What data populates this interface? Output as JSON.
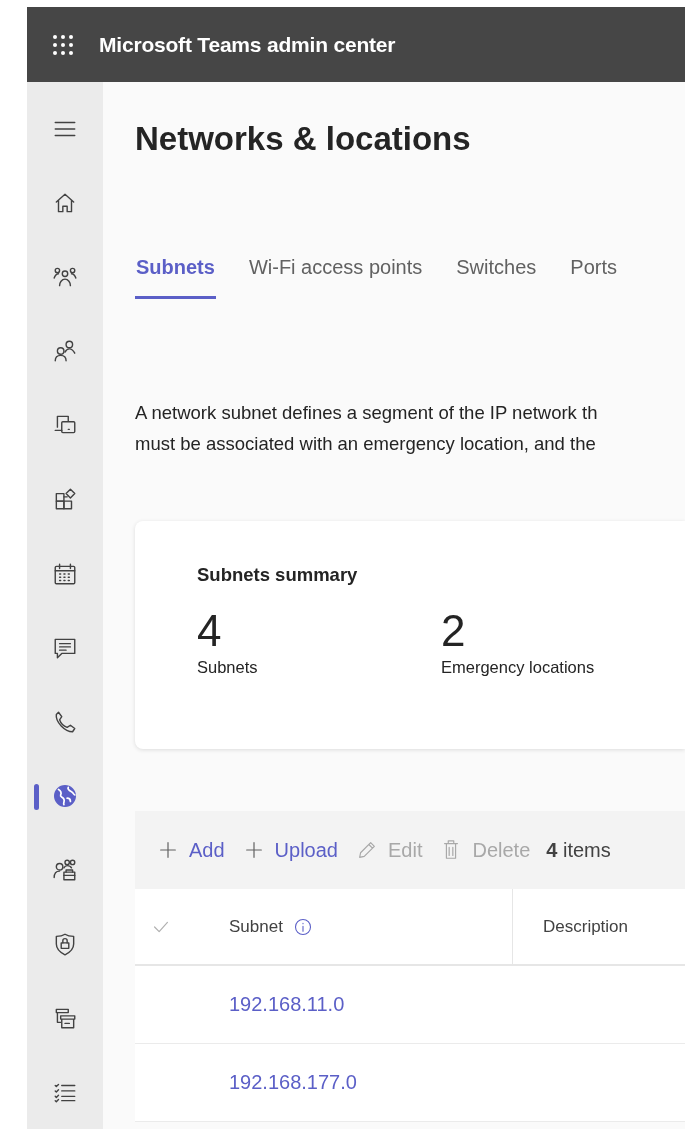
{
  "header": {
    "title": "Microsoft Teams admin center"
  },
  "sidebar": {
    "items": [
      {
        "kind": "menu",
        "selected": false
      },
      {
        "kind": "home",
        "selected": false
      },
      {
        "kind": "teams",
        "selected": false
      },
      {
        "kind": "users",
        "selected": false
      },
      {
        "kind": "devices",
        "selected": false
      },
      {
        "kind": "apps",
        "selected": false
      },
      {
        "kind": "calendar",
        "selected": false
      },
      {
        "kind": "chat",
        "selected": false
      },
      {
        "kind": "phone",
        "selected": false
      },
      {
        "kind": "globe",
        "selected": true
      },
      {
        "kind": "people-lock",
        "selected": false
      },
      {
        "kind": "shield",
        "selected": false
      },
      {
        "kind": "archive",
        "selected": false
      },
      {
        "kind": "checklist",
        "selected": false
      }
    ]
  },
  "page": {
    "title": "Networks & locations"
  },
  "tabs": [
    {
      "label": "Subnets",
      "selected": true
    },
    {
      "label": "Wi-Fi access points",
      "selected": false
    },
    {
      "label": "Switches",
      "selected": false
    },
    {
      "label": "Ports",
      "selected": false
    }
  ],
  "description": [
    "A network subnet defines a segment of the IP network th",
    "must be associated with an emergency location, and the"
  ],
  "summary": {
    "title": "Subnets summary",
    "stats": [
      {
        "value": "4",
        "label": "Subnets"
      },
      {
        "value": "2",
        "label": "Emergency locations"
      }
    ]
  },
  "toolbar": {
    "actions": [
      {
        "kind": "add",
        "label": "Add",
        "disabled": false
      },
      {
        "kind": "upload",
        "label": "Upload",
        "disabled": false
      },
      {
        "kind": "edit",
        "label": "Edit",
        "disabled": true
      },
      {
        "kind": "delete",
        "label": "Delete",
        "disabled": true
      }
    ],
    "count": "**4** items"
  },
  "table": {
    "columns": [
      "Subnet",
      "Description"
    ],
    "rows": [
      {
        "subnet": "192.168.11.0"
      },
      {
        "subnet": "192.168.177.0"
      }
    ]
  }
}
